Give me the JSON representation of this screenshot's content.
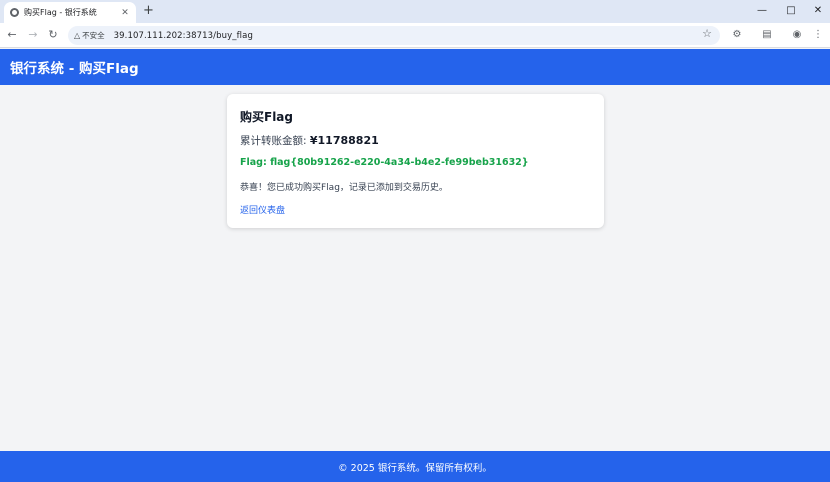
{
  "browser": {
    "tab_title": "购买Flag - 银行系统",
    "tab_close": "✕",
    "new_tab": "+",
    "insecure_label": "不安全",
    "url": "39.107.111.202:38713/buy_flag",
    "icons": [
      "back-icon",
      "forward-icon",
      "reload-icon",
      "warning-icon",
      "star-icon",
      "extensions-icon",
      "reading-mode-icon",
      "profile-icon",
      "menu-icon",
      "minimize-icon",
      "maximize-icon",
      "close-icon"
    ]
  },
  "header": {
    "title": "银行系统 - 购买Flag"
  },
  "card": {
    "title": "购买Flag",
    "amount_label": "累计转账金额: ",
    "amount_value": "¥11788821",
    "flag": "Flag: flag{80b91262-e220-4a34-b4e2-fe99beb31632}",
    "message": "恭喜！您已成功购买Flag，记录已添加到交易历史。",
    "back_link": "返回仪表盘"
  },
  "footer": {
    "text": "© 2025 银行系统。保留所有权利。"
  },
  "colors": {
    "primary": "#2563eb",
    "flag_green": "#16a34a",
    "background": "#f3f4f6"
  }
}
